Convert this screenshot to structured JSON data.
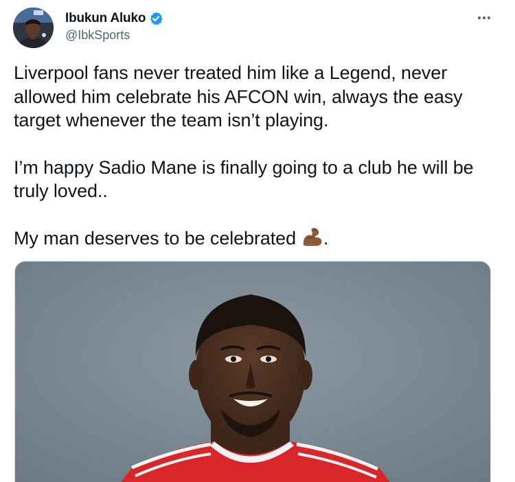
{
  "author": {
    "display_name": "Ibukun Aluko",
    "handle": "@IbkSports",
    "verified": true
  },
  "tweet": {
    "paragraphs": [
      "Liverpool fans never treated him like a Legend, never allowed him celebrate his AFCON win, always the easy target whenever the team isn’t playing.",
      "I’m happy Sadio Mane is finally going to a club he will be truly loved..",
      "My man deserves to be celebrated"
    ],
    "last_paragraph_suffix": ".",
    "emoji": "flexed-biceps-medium-dark-skin"
  },
  "icons": {
    "verified": "verified-badge-icon",
    "more": "more-options-icon"
  },
  "colors": {
    "verified_blue": "#1d9bf0",
    "text": "#0f1419",
    "secondary_text": "#536471",
    "jersey_red": "#d9262a",
    "backdrop": "#7e8c97"
  }
}
